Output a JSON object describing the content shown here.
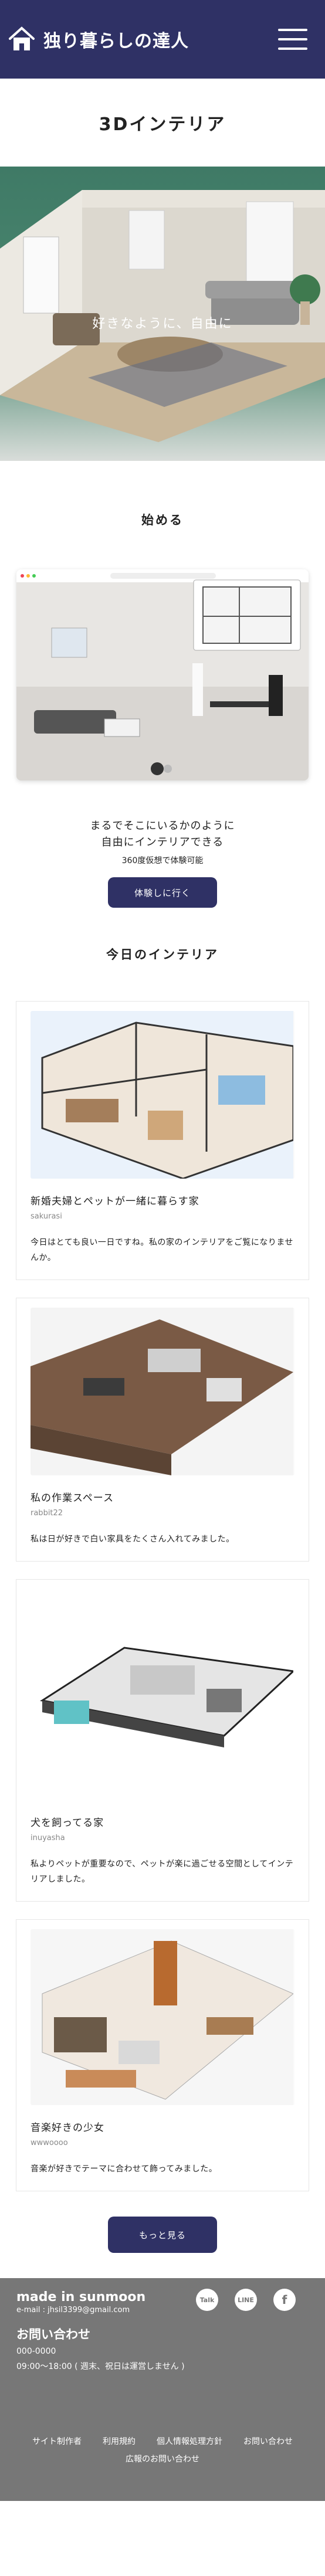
{
  "header": {
    "title": "独り暮らしの達人"
  },
  "hero": {
    "title": "3Dインテリア",
    "caption": "好きなように、自由に"
  },
  "start": {
    "title": "始める",
    "lead_line1": "まるでそこにいるかのように",
    "lead_line2": "自由にインテリアできる",
    "sub": "360度仮想で体験可能",
    "button": "体験しに行く"
  },
  "today": {
    "title": "今日のインテリア",
    "cards": [
      {
        "title": "新婚夫婦とペットが一緒に暮らす家",
        "author": "sakurasi",
        "desc": "今日はとても良い一日ですね。私の家のインテリアをご覧になりませんか。"
      },
      {
        "title": "私の作業スペース",
        "author": "rabbit22",
        "desc": "私は日が好きで白い家具をたくさん入れてみました。"
      },
      {
        "title": "犬を飼ってる家",
        "author": "inuyasha",
        "desc": "私よりペットが重要なので、ペットが楽に過ごせる空間としてインテリアしました。"
      },
      {
        "title": "音楽好きの少女",
        "author": "wwwoooo",
        "desc": "音楽が好きでテーマに合わせて飾ってみました。"
      }
    ],
    "more_button": "もっと見る"
  },
  "footer": {
    "maker": "made in sunmoon",
    "mail": "e-mail : jhsil3399@gmail.com",
    "contact_title": "お問い合わせ",
    "contact_tel": "000-0000",
    "contact_hours": "09:00～18:00 ( 週末、祝日は運営しません )",
    "links": [
      "サイト制作者",
      "利用規約",
      "個人情報処理方針",
      "お問い合わせ"
    ],
    "links2": "広報のお問い合わせ",
    "social": [
      "Talk",
      "LINE",
      "f"
    ]
  },
  "colors": {
    "brand": "#2f3165",
    "footer": "#777777"
  }
}
